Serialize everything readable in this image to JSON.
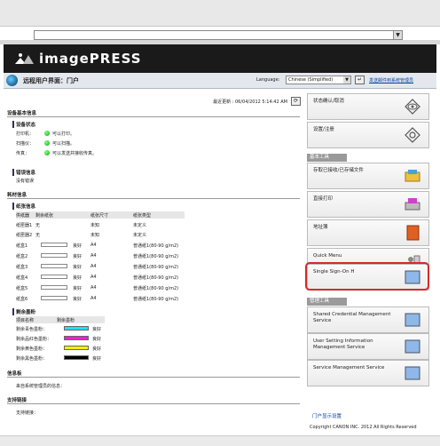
{
  "browser": {
    "address_dropdown": "▼"
  },
  "banner": {
    "brand": "imagePRESS"
  },
  "subheader": {
    "title": "远程用户界面：门户",
    "language_label": "Language:",
    "language_value": "Chinese (Simplified)",
    "language_dropdown": "▼",
    "go_button": "↵",
    "system_link": "发送邮件到系统管理员"
  },
  "main": {
    "last_updated": "最近更新 : 06/04/2012 5:14:42 AM",
    "refresh_button": "⟳",
    "device_info": {
      "heading": "设备基本信息",
      "status_heading": "设备状态",
      "rows": [
        {
          "label": "打印机：",
          "value": "可以打印。"
        },
        {
          "label": "扫描仪：",
          "value": "可以扫描。"
        },
        {
          "label": "传真：",
          "value": "可以发送并接收传真。"
        }
      ]
    },
    "error_info": {
      "heading": "错误信息",
      "text": "没有错误"
    },
    "consumables": {
      "heading": "耗材信息",
      "paper_heading": "纸张信息",
      "columns": [
        "供纸器",
        "剩余纸张",
        "纸张尺寸",
        "纸张类型"
      ],
      "rows": [
        {
          "source": "纸匣器1",
          "remain": "无",
          "size": "未知",
          "type": "未定义"
        },
        {
          "source": "纸匣器2",
          "remain": "无",
          "size": "未知",
          "type": "未定义"
        },
        {
          "source": "纸盒1",
          "remain": "良好",
          "size": "A4",
          "type": "普通纸1(80-90 g/m2)"
        },
        {
          "source": "纸盒2",
          "remain": "良好",
          "size": "A4",
          "type": "普通纸1(80-90 g/m2)"
        },
        {
          "source": "纸盒3",
          "remain": "良好",
          "size": "A4",
          "type": "普通纸1(80-90 g/m2)"
        },
        {
          "source": "纸盒4",
          "remain": "良好",
          "size": "A4",
          "type": "普通纸1(80-90 g/m2)"
        },
        {
          "source": "纸盒5",
          "remain": "良好",
          "size": "A4",
          "type": "普通纸1(80-90 g/m2)"
        },
        {
          "source": "纸盒6",
          "remain": "良好",
          "size": "A4",
          "type": "普通纸1(80-90 g/m2)"
        }
      ],
      "toner_heading": "剩余墨粉",
      "toner_columns": [
        "项目名称",
        "剩余墨粉"
      ],
      "toner": [
        {
          "name": "剩余青色墨粉：",
          "status": "良好",
          "color": "#22e0f0"
        },
        {
          "name": "剩余品红色墨粉：",
          "status": "良好",
          "color": "#ee22cc"
        },
        {
          "name": "剩余黄色墨粉：",
          "status": "良好",
          "color": "#f4f000"
        },
        {
          "name": "剩余黑色墨粉：",
          "status": "良好",
          "color": "#000000"
        }
      ]
    },
    "message_board": {
      "heading": "信息板",
      "text": "来自系统管理员的信息："
    },
    "support": {
      "heading": "支持链接",
      "text": "支持链接："
    }
  },
  "sidebar": {
    "cards_top": [
      {
        "label": "状态确认/取消"
      },
      {
        "label": "设置/注册"
      }
    ],
    "basic_tools_heading": "基本工具",
    "basic_tools": [
      {
        "label": "存取已接收/已存储文件"
      },
      {
        "label": "直接打印"
      },
      {
        "label": "地址簿"
      },
      {
        "label": "Quick Menu"
      },
      {
        "label": "Single Sign-On H"
      }
    ],
    "admin_tools_heading": "管理工具",
    "admin_tools": [
      {
        "label": "Shared Credential Management Service"
      },
      {
        "label": "User Setting Information Management Service"
      },
      {
        "label": "Service Management Service"
      }
    ],
    "portal_link": "门户显示设置",
    "copyright": "Copyright CANON INC. 2012 All Rights Reserved"
  }
}
